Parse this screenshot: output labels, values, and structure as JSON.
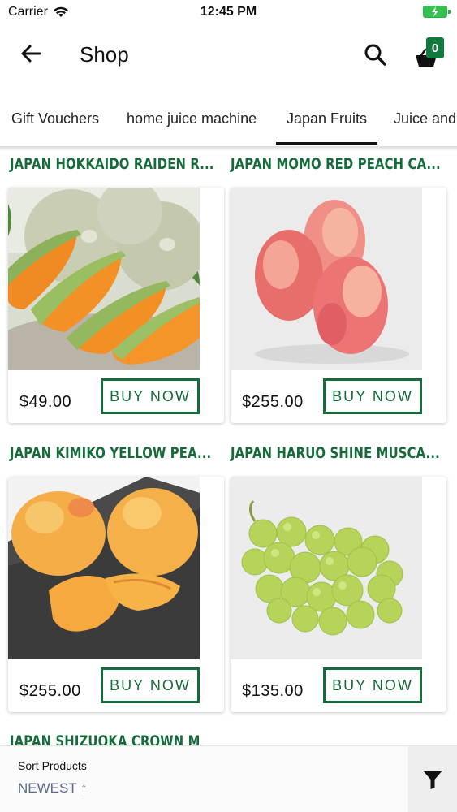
{
  "status_bar": {
    "carrier": "Carrier",
    "time": "12:45 PM"
  },
  "header": {
    "title": "Shop",
    "cart_count": "0"
  },
  "tabs": [
    {
      "label": "Gift Vouchers"
    },
    {
      "label": "home juice machine"
    },
    {
      "label": "Japan Fruits"
    },
    {
      "label": "Juice and"
    }
  ],
  "products": [
    {
      "title": "JAPAN HOKKAIDO RAIDEN R...",
      "price": "$49.00",
      "button": "BUY NOW",
      "image": "cantaloupe-melon-slices"
    },
    {
      "title": "JAPAN MOMO RED PEACH CA...",
      "price": "$255.00",
      "button": "BUY NOW",
      "image": "red-peaches"
    },
    {
      "title": "JAPAN KIMIKO YELLOW PEA...",
      "price": "$255.00",
      "button": "BUY NOW",
      "image": "yellow-peaches"
    },
    {
      "title": "JAPAN HARUO SHINE MUSCA...",
      "price": "$135.00",
      "button": "BUY NOW",
      "image": "green-grapes"
    }
  ],
  "partial_product": {
    "title": "JAPAN SHIZUOKA CROWN M"
  },
  "sort": {
    "label": "Sort Products",
    "value": "NEWEST ↑"
  },
  "colors": {
    "accent": "#156b3a",
    "badge": "#0f7a3c",
    "sort_value": "#5a6a8a"
  }
}
